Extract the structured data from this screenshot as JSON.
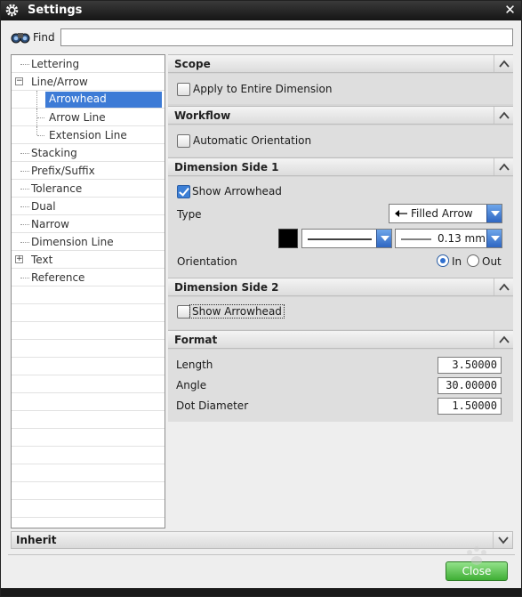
{
  "window": {
    "title": "Settings"
  },
  "find": {
    "label": "Find",
    "value": ""
  },
  "tree": {
    "items": [
      {
        "label": "Lettering",
        "level": 1
      },
      {
        "label": "Line/Arrow",
        "level": 1,
        "expander": "−"
      },
      {
        "label": "Arrowhead",
        "level": 2,
        "selected": true
      },
      {
        "label": "Arrow Line",
        "level": 2
      },
      {
        "label": "Extension Line",
        "level": 2
      },
      {
        "label": "Stacking",
        "level": 1
      },
      {
        "label": "Prefix/Suffix",
        "level": 1
      },
      {
        "label": "Tolerance",
        "level": 1
      },
      {
        "label": "Dual",
        "level": 1
      },
      {
        "label": "Narrow",
        "level": 1
      },
      {
        "label": "Dimension Line",
        "level": 1
      },
      {
        "label": "Text",
        "level": 1,
        "expander": "+"
      },
      {
        "label": "Reference",
        "level": 1
      }
    ]
  },
  "scope": {
    "title": "Scope",
    "apply_label": "Apply to Entire Dimension",
    "apply_checked": false
  },
  "workflow": {
    "title": "Workflow",
    "auto_label": "Automatic Orientation",
    "auto_checked": false
  },
  "side1": {
    "title": "Dimension Side 1",
    "show_label": "Show Arrowhead",
    "show_checked": true,
    "type_label": "Type",
    "type_value": "Filled Arrow",
    "color": "#000000",
    "line_width": "0.13 mm",
    "orientation_label": "Orientation",
    "orient_in": "In",
    "orient_out": "Out",
    "orient_selected": "In"
  },
  "side2": {
    "title": "Dimension Side 2",
    "show_label": "Show Arrowhead",
    "show_checked": false
  },
  "format": {
    "title": "Format",
    "length_label": "Length",
    "length_value": "3.50000",
    "angle_label": "Angle",
    "angle_value": "30.00000",
    "dot_label": "Dot Diameter",
    "dot_value": "1.50000"
  },
  "inherit": {
    "label": "Inherit"
  },
  "close_button": "Close",
  "colors": {
    "accent": "#3d7bd6",
    "close_green": "#3fae35",
    "titlebar": "#1e1e1e"
  }
}
